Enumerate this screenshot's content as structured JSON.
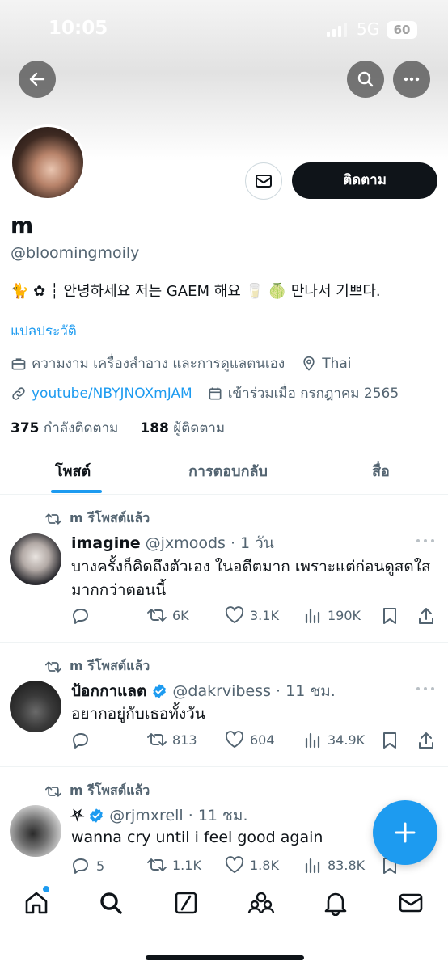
{
  "status_bar": {
    "time": "10:05",
    "network": "5G",
    "battery": "60"
  },
  "header": {
    "back_icon": "arrow-left-icon",
    "search_icon": "search-icon",
    "more_icon": "more-icon"
  },
  "profile": {
    "display_name": "m",
    "handle": "@bloomingmoily",
    "bio": "🐈 ✿ ┆ 안녕하세요 저는 GAEM 해요 🥛 🍈 만나서 기쁘다.",
    "translate_label": "แปลประวัติ",
    "category": "ความงาม เครื่องสำอาง และการดูแลตนเอง",
    "location": "Thai",
    "website": "youtube/NBYJNOXmJAM",
    "joined": "เข้าร่วมเมื่อ กรกฎาคม 2565",
    "following_count": "375",
    "following_label": "กำลังติดตาม",
    "followers_count": "188",
    "followers_label": "ผู้ติดตาม",
    "follow_label": "ติดตาม"
  },
  "tabs": [
    {
      "label": "โพสต์",
      "active": true
    },
    {
      "label": "การตอบกลับ",
      "active": false
    },
    {
      "label": "สื่อ",
      "active": false
    }
  ],
  "posts": [
    {
      "repost_label": "m รีโพสต์แล้ว",
      "author": "imagine",
      "username": "@jxmoods",
      "time": "· 1 วัน",
      "verified": false,
      "text": "บางครั้งก็คิดถึงตัวเอง ในอดีตมาก เพราะแต่ก่อนดูสดใสมากกว่าตอนนี้",
      "replies": "",
      "reposts": "6K",
      "likes": "3.1K",
      "views": "190K"
    },
    {
      "repost_label": "m รีโพสต์แล้ว",
      "author": "ป้อกกาแลต",
      "username": "@dakrvibess",
      "time": "· 11 ชม.",
      "verified": true,
      "text": "อยากอยู่กับเธอทั้งวัน",
      "replies": "",
      "reposts": "813",
      "likes": "604",
      "views": "34.9K"
    },
    {
      "repost_label": "m รีโพสต์แล้ว",
      "author": "⛧",
      "username": "@rjmxrell",
      "time": "· 11 ชม.",
      "verified": true,
      "text": "wanna cry until i feel good again",
      "replies": "5",
      "reposts": "1.1K",
      "likes": "1.8K",
      "views": "83.8K"
    }
  ],
  "bottom_nav": [
    "home-icon",
    "search-icon",
    "grok-icon",
    "communities-icon",
    "notifications-icon",
    "messages-icon"
  ],
  "colors": {
    "accent": "#1d9bf0",
    "text": "#0f1419",
    "secondary": "#536471"
  }
}
